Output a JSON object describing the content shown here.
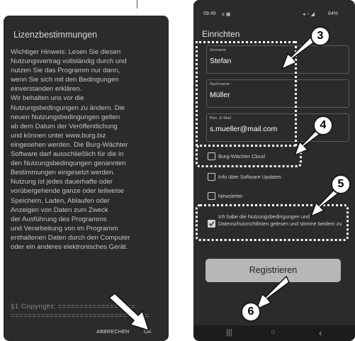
{
  "left": {
    "title": "Lizenzbestimmungen",
    "body_lines": [
      "Wichtiger Hinweis: Lesen Sie diesen",
      "Nutzungsvertrag vollständig durch und",
      "nutzen Sie das Programm nur dann,",
      "wenn Sie sich mit den Bedingungen",
      "einverstanden erklären.",
      "Wir behalten uns vor die",
      "Nutzungsbedingungen zu ändern. Die",
      "neuen Nutzungsbedingungen gelten",
      "ab dem Datum der Veröffentlichung",
      "und können unter www.burg.biz",
      "eingesehen werden. Die Burg-Wächter",
      "Software darf ausschließlich für die in",
      "den Nutzungsbedingungen genannten",
      "Bestimmungen eingesetzt werden.",
      "Nutzung ist jedes dauerhafte oder",
      "vorübergehende ganze oder teilweise",
      "Speichern, Laden, Ablaufen oder",
      "Anzeigen von Daten zum Zweck",
      "der Ausführung des Programms",
      "und Verarbeitung von im Programm",
      "enthaltenen Daten durch den Computer",
      "oder ein anderes elektronisches Gerät."
    ],
    "copyright_line": "§1 Copyright: ==================",
    "rule_line": "================================",
    "cancel_label": "ABBRECHEN",
    "ok_label": "OK"
  },
  "right": {
    "status_time": "09:49",
    "status_right": "84%",
    "title": "Einrichten",
    "fields": [
      {
        "label": "Vorname",
        "value": "Stefan"
      },
      {
        "label": "Nachname",
        "value": "Müller"
      },
      {
        "label": "Ben. E-Mail",
        "value": "s.mueller@mail.com"
      }
    ],
    "checkboxes": [
      {
        "label": "Burg-Wächter Cloud",
        "checked": false
      },
      {
        "label": "Info über Software Updates",
        "checked": false
      },
      {
        "label": "Newsletter",
        "checked": false
      },
      {
        "label": "Ich habe die Nutzungsbedingungen und Datenschutzrichtlinien gelesen und stimme beidem zu",
        "checked": true
      }
    ],
    "register_label": "Registrieren",
    "nav": {
      "recent": "|||",
      "home": "○",
      "back": "‹"
    }
  },
  "callouts": [
    "3",
    "4",
    "5",
    "6"
  ]
}
